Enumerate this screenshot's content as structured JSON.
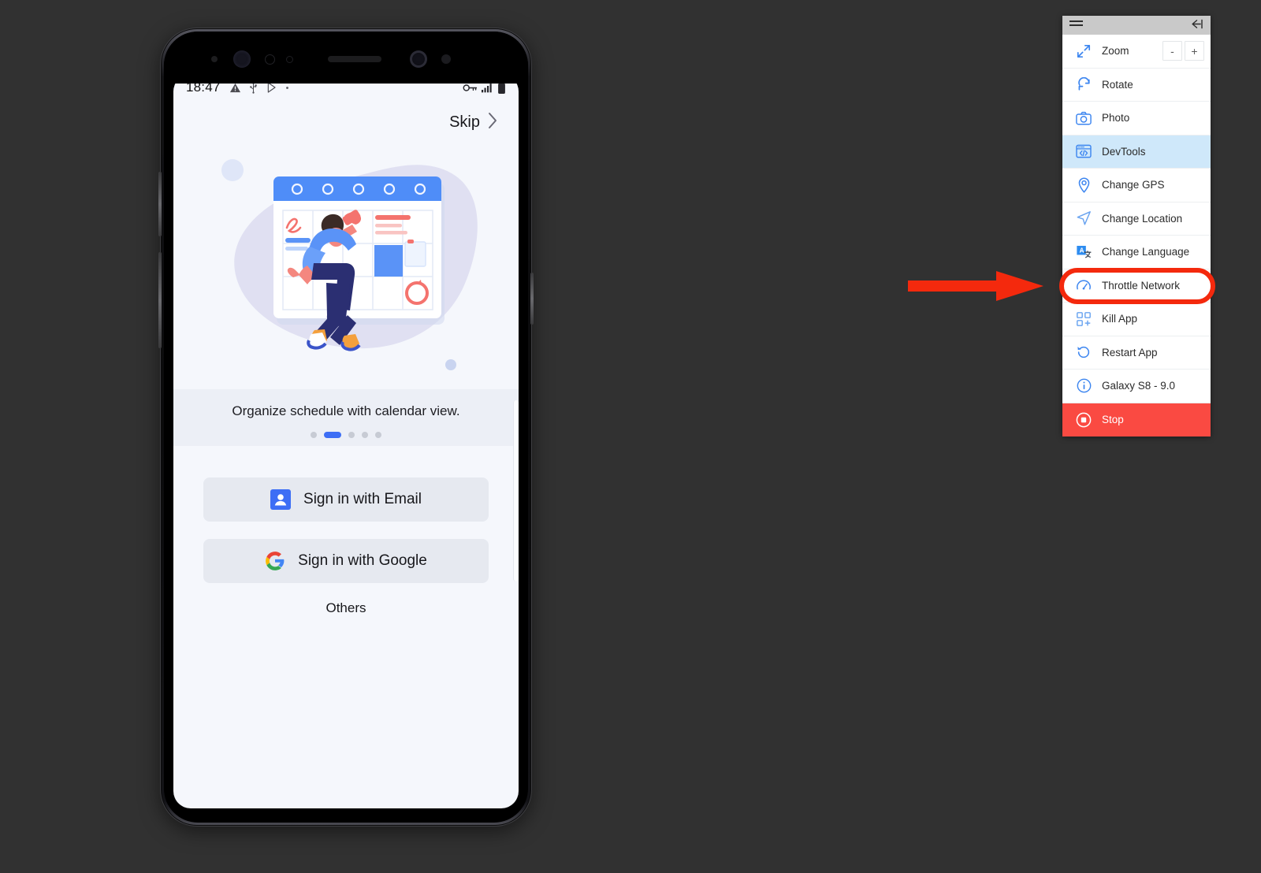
{
  "background_color": "#313131",
  "phone": {
    "device_frame": "samsung-galaxy-s8",
    "status_bar": {
      "time": "18:47",
      "left_icons": [
        "warning-triangle-icon",
        "usb-icon",
        "play-store-icon",
        "dot-icon"
      ],
      "right_icons": [
        "vpn-key-icon",
        "signal-bars-icon",
        "battery-icon"
      ]
    },
    "skip": {
      "label": "Skip",
      "chevron": "chevron-right-icon"
    },
    "illustration": {
      "name": "calendar-onboarding-illustration",
      "alt": "Person jumping in front of a large calendar"
    },
    "caption": "Organize schedule with calendar view.",
    "pager": {
      "total": 5,
      "active_index": 1
    },
    "auth_buttons": [
      {
        "icon": "person-badge-icon",
        "label": "Sign in with Email"
      },
      {
        "icon": "google-g-icon",
        "label": "Sign in with Google"
      }
    ],
    "others_label": "Others"
  },
  "tool_panel": {
    "header": {
      "menu_icon": "hamburger-icon",
      "collapse_icon": "collapse-left-icon"
    },
    "items": [
      {
        "id": "zoom",
        "label": "Zoom",
        "icon": "expand-arrows-icon",
        "state": "normal",
        "controls": {
          "minus": "-",
          "plus": "+"
        }
      },
      {
        "id": "rotate",
        "label": "Rotate",
        "icon": "rotate-icon",
        "state": "normal"
      },
      {
        "id": "photo",
        "label": "Photo",
        "icon": "camera-icon",
        "state": "normal"
      },
      {
        "id": "devtools",
        "label": "DevTools",
        "icon": "code-window-icon",
        "state": "selected"
      },
      {
        "id": "change-gps",
        "label": "Change GPS",
        "icon": "map-pin-icon",
        "state": "normal"
      },
      {
        "id": "change-location",
        "label": "Change Location",
        "icon": "navigation-arrow-icon",
        "state": "normal"
      },
      {
        "id": "change-language",
        "label": "Change Language",
        "icon": "translate-icon",
        "state": "normal"
      },
      {
        "id": "throttle-network",
        "label": "Throttle Network",
        "icon": "speedometer-icon",
        "state": "highlighted"
      },
      {
        "id": "kill-app",
        "label": "Kill App",
        "icon": "app-grid-plus-icon",
        "state": "normal"
      },
      {
        "id": "restart-app",
        "label": "Restart App",
        "icon": "restart-icon",
        "state": "normal"
      },
      {
        "id": "device-info",
        "label": "Galaxy S8 - 9.0",
        "icon": "info-circle-icon",
        "state": "normal"
      },
      {
        "id": "stop",
        "label": "Stop",
        "icon": "stop-circle-icon",
        "state": "danger"
      }
    ]
  },
  "annotation": {
    "arrow": {
      "name": "red-pointer-arrow",
      "color": "#f4290d",
      "points_to": "throttle-network"
    },
    "highlight": {
      "name": "red-highlight-ring",
      "color": "#f4290d",
      "target": "throttle-network"
    }
  },
  "colors": {
    "accent_blue": "#3d6ef5",
    "selected_row": "#cfe8fa",
    "danger_red": "#fa4a42",
    "annotation_red": "#f4290d",
    "panel_header": "#c9c9c9",
    "screen_bg": "#f5f7fc"
  }
}
